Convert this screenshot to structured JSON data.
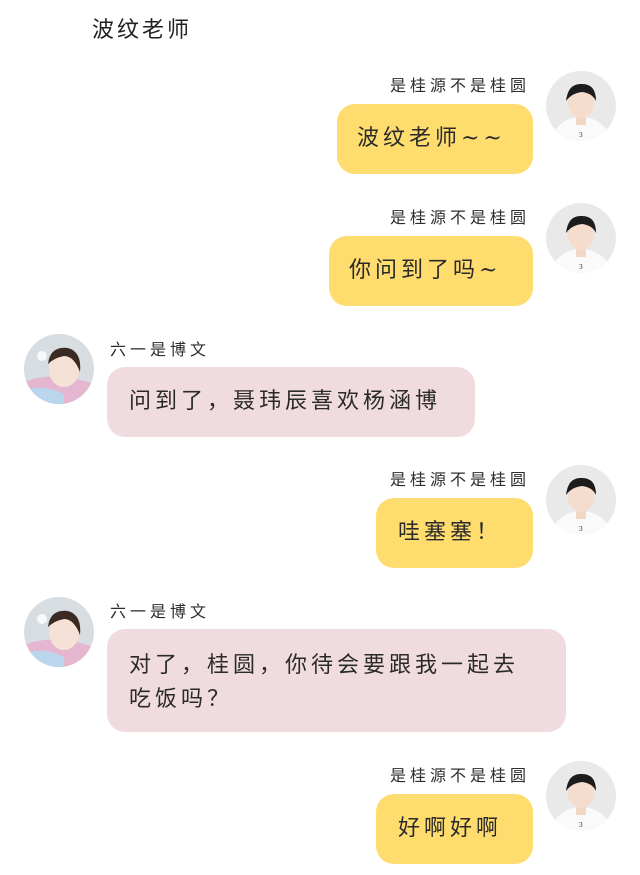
{
  "header": {
    "title": "波纹老师"
  },
  "messages": [
    {
      "side": "right",
      "sender": "是桂源不是桂圆",
      "text": "波纹老师~~"
    },
    {
      "side": "right",
      "sender": "是桂源不是桂圆",
      "text": "你问到了吗~"
    },
    {
      "side": "left",
      "sender": "六一是博文",
      "text": "问到了，聂玮辰喜欢杨涵博"
    },
    {
      "side": "right",
      "sender": "是桂源不是桂圆",
      "text": "哇塞塞！"
    },
    {
      "side": "left",
      "sender": "六一是博文",
      "text": "对了，桂圆，你待会要跟我一起去吃饭吗？"
    },
    {
      "side": "right",
      "sender": "是桂源不是桂圆",
      "text": "好啊好啊"
    }
  ],
  "colors": {
    "right_bubble": "#fedc6e",
    "left_bubble": "#f0dcdf",
    "background": "#ffffff"
  },
  "icons": {
    "right_avatar": "boy-avatar",
    "left_avatar": "girl-avatar"
  }
}
